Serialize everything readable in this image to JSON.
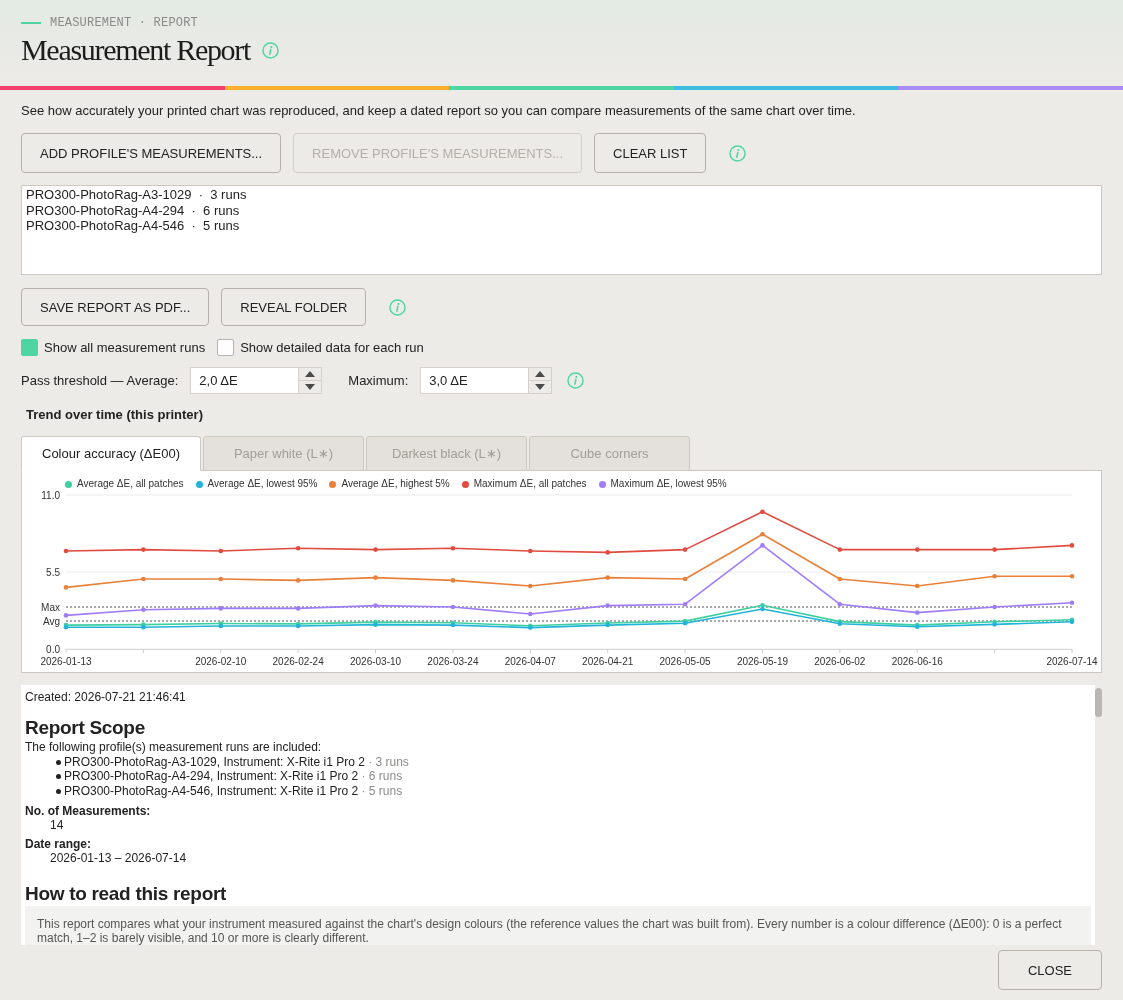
{
  "header": {
    "eyebrow": "MEASUREMENT · REPORT",
    "title": "Measurement Report"
  },
  "description": "See how accurately your printed chart was reproduced, and keep a dated report so you can compare measurements of the same chart over time.",
  "profile_actions": [
    {
      "label": "ADD PROFILE'S MEASUREMENTS...",
      "disabled": false
    },
    {
      "label": "REMOVE PROFILE'S MEASUREMENTS...",
      "disabled": true
    },
    {
      "label": "CLEAR LIST",
      "disabled": false
    }
  ],
  "profile_list": [
    {
      "label": "PRO300-PhotoRag-A3-1029  ·  3 runs",
      "selected": false
    },
    {
      "label": "PRO300-PhotoRag-A4-294  ·  6 runs",
      "selected": false
    },
    {
      "label": "PRO300-PhotoRag-A4-546  ·  5 runs",
      "selected": false
    }
  ],
  "report_actions": [
    {
      "label": "SAVE REPORT AS PDF..."
    },
    {
      "label": "REVEAL FOLDER"
    }
  ],
  "options": [
    {
      "label": "Show all measurement runs",
      "checked": true
    },
    {
      "label": "Show detailed data for each run",
      "checked": false
    }
  ],
  "thresholds": [
    {
      "label": "Pass threshold — Average:",
      "value": "2,0 ΔE"
    },
    {
      "label": "Maximum:",
      "value": "3,0 ΔE"
    }
  ],
  "trend": {
    "heading": "Trend over time (this printer)",
    "tabs": [
      {
        "label": "Colour accuracy (ΔE00)",
        "selected": true
      },
      {
        "label": "Paper white (L∗)",
        "selected": false
      },
      {
        "label": "Darkest black (L∗)",
        "selected": false
      },
      {
        "label": "Cube corners",
        "selected": false
      }
    ],
    "chart_data": {
      "type": "line",
      "legend": "top",
      "categories": [
        "2026-01-13",
        null,
        "2026-02-10",
        "2026-02-24",
        "2026-03-10",
        "2026-03-24",
        "2026-04-07",
        "2026-04-21",
        "2026-05-05",
        "2026-05-19",
        "2026-06-02",
        "2026-06-16",
        null,
        "2026-07-14"
      ],
      "ylim": [
        0,
        11
      ],
      "yticks": [
        {
          "value": 0,
          "label": "0.0"
        },
        {
          "value": 5.5,
          "label": "5.5"
        },
        {
          "value": 11,
          "label": "11.0"
        }
      ],
      "series": [
        {
          "name": "Average ΔE, all patches",
          "color": "#3fd0a0",
          "values": [
            1.71,
            1.74,
            1.82,
            1.79,
            1.92,
            1.87,
            1.66,
            1.86,
            1.99,
            3.13,
            1.96,
            1.71,
            1.94,
            2.09
          ]
        },
        {
          "name": "Average ΔE, lowest 95%",
          "color": "#22b4d8",
          "values": [
            1.56,
            1.56,
            1.64,
            1.64,
            1.74,
            1.71,
            1.53,
            1.71,
            1.84,
            2.86,
            1.81,
            1.59,
            1.76,
            1.94
          ]
        },
        {
          "name": "Average ΔE, highest 5%",
          "color": "#e8803a",
          "values": [
            4.4,
            5.0,
            5.0,
            4.9,
            5.1,
            4.9,
            4.5,
            5.1,
            5.0,
            8.2,
            5.0,
            4.5,
            5.2,
            5.2
          ]
        },
        {
          "name": "Maximum ΔE, all patches",
          "color": "#e04b3f",
          "values": [
            7.0,
            7.1,
            7.0,
            7.2,
            7.1,
            7.2,
            7.0,
            6.9,
            7.1,
            9.8,
            7.1,
            7.1,
            7.1,
            7.4
          ]
        },
        {
          "name": "Maximum ΔE, lowest 95%",
          "color": "#a07cf8",
          "values": [
            2.4,
            2.8,
            2.9,
            2.9,
            3.1,
            3.0,
            2.5,
            3.1,
            3.2,
            7.4,
            3.2,
            2.6,
            3.0,
            3.3
          ]
        }
      ],
      "ref_lines": [
        {
          "axis": "y",
          "value": 3,
          "label": "Max"
        },
        {
          "axis": "y",
          "value": 2,
          "label": "Avg"
        }
      ]
    }
  },
  "report": {
    "created": "Created: 2026-07-21 21:46:41",
    "scope": {
      "heading": "Report Scope",
      "intro": "The following profile(s) measurement runs are included:",
      "profiles": [
        {
          "name": "PRO300-PhotoRag-A3-1029, Instrument: X-Rite i1 Pro 2",
          "runs": "· 3 runs"
        },
        {
          "name": "PRO300-PhotoRag-A4-294, Instrument: X-Rite i1 Pro 2",
          "runs": "· 6 runs"
        },
        {
          "name": "PRO300-PhotoRag-A4-546, Instrument: X-Rite i1 Pro 2",
          "runs": "· 5 runs"
        }
      ],
      "fields": [
        {
          "label": "No. of Measurements:",
          "value": "14"
        },
        {
          "label": "Date range:",
          "value": "2026-01-13 – 2026-07-14"
        }
      ]
    },
    "guide": {
      "heading": "How to read this report",
      "text": "This report compares what your instrument measured against the chart's design colours (the reference values the chart was built from). Every number is a colour difference (ΔE00): 0 is a perfect match, 1–2 is barely visible, and 10 or more is clearly different."
    }
  },
  "close_button": "CLOSE"
}
